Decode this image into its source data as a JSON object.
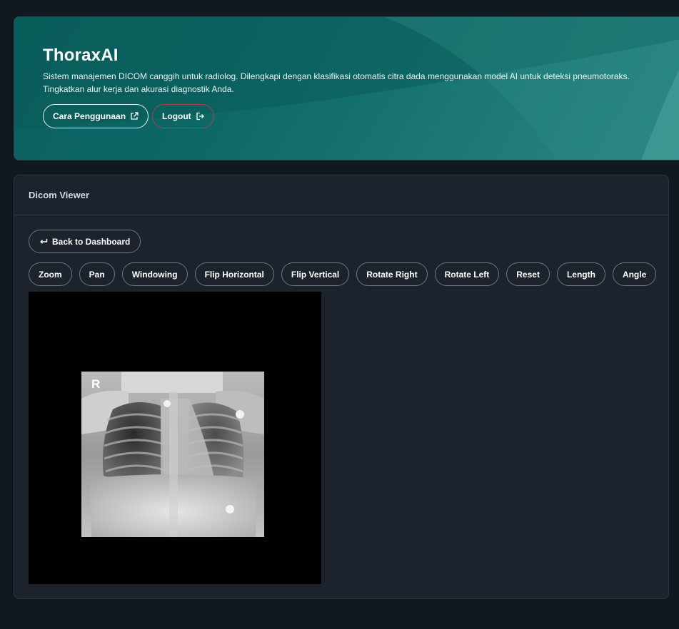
{
  "hero": {
    "title": "ThoraxAI",
    "description": "Sistem manajemen DICOM canggih untuk radiolog. Dilengkapi dengan klasifikasi otomatis citra dada menggunakan model AI untuk deteksi pneumotoraks. Tingkatkan alur kerja dan akurasi diagnostik Anda.",
    "guide_label": "Cara Penggunaan",
    "logout_label": "Logout"
  },
  "viewer": {
    "title": "Dicom Viewer",
    "back_label": "Back to Dashboard",
    "tools": [
      "Zoom",
      "Pan",
      "Windowing",
      "Flip Horizontal",
      "Flip Vertical",
      "Rotate Right",
      "Rotate Left",
      "Reset",
      "Length",
      "Angle"
    ],
    "orientation_marker": "R"
  },
  "colors": {
    "accent": "#0d6866",
    "background": "#121820",
    "card": "#1c232d",
    "logout_border": "#a8444a"
  }
}
